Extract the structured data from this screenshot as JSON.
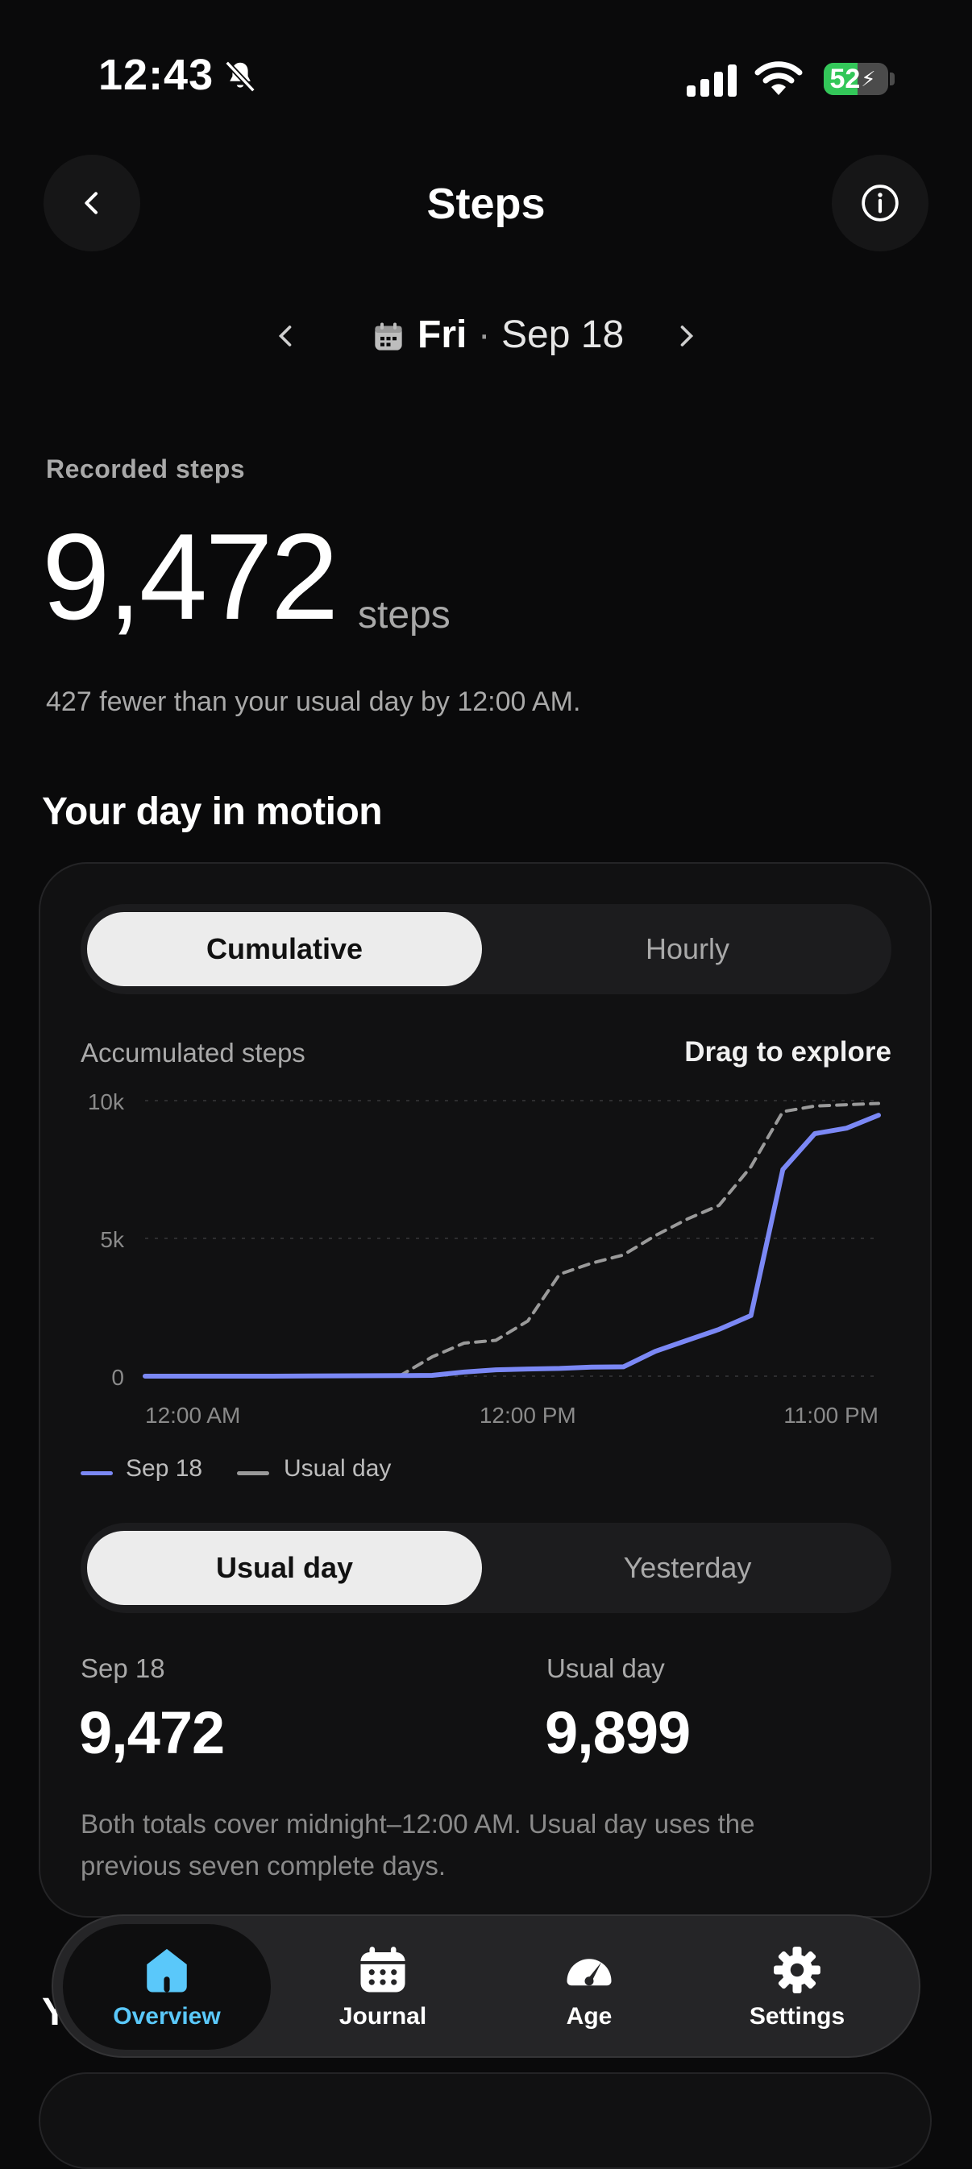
{
  "status_bar": {
    "time": "12:43",
    "battery": "52"
  },
  "header": {
    "title": "Steps"
  },
  "date_nav": {
    "day": "Fri",
    "separator": "·",
    "date": "Sep 18"
  },
  "summary": {
    "label": "Recorded steps",
    "value": "9,472",
    "unit": "steps",
    "comparison": "427 fewer than your usual day by 12:00 AM."
  },
  "section": {
    "title": "Your day in motion"
  },
  "chart_tabs": {
    "options": [
      "Cumulative",
      "Hourly"
    ],
    "selected": "Cumulative"
  },
  "chart_header": {
    "label": "Accumulated steps",
    "hint": "Drag to explore"
  },
  "chart_data": {
    "type": "line",
    "ylabel": "Accumulated steps",
    "y_ticks": [
      "10k",
      "5k",
      "0"
    ],
    "x_ticks": [
      "12:00 AM",
      "12:00 PM",
      "11:00 PM"
    ],
    "ylim": [
      0,
      10000
    ],
    "x_unit": "hour of day",
    "xlim": [
      0,
      23
    ],
    "grid": true,
    "legend_position": "bottom-left",
    "series": [
      {
        "name": "Sep 18",
        "color": "#7b88f5",
        "style": "solid",
        "points": [
          [
            0,
            0
          ],
          [
            4,
            0
          ],
          [
            8,
            20
          ],
          [
            9,
            30
          ],
          [
            10,
            150
          ],
          [
            11,
            230
          ],
          [
            12,
            260
          ],
          [
            13,
            280
          ],
          [
            14,
            330
          ],
          [
            15,
            340
          ],
          [
            16,
            900
          ],
          [
            17,
            1300
          ],
          [
            18,
            1700
          ],
          [
            19,
            2200
          ],
          [
            20,
            7500
          ],
          [
            21,
            8800
          ],
          [
            22,
            9000
          ],
          [
            23,
            9472
          ]
        ]
      },
      {
        "name": "Usual day",
        "color": "#9a9a9a",
        "style": "dashed",
        "points": [
          [
            0,
            0
          ],
          [
            4,
            0
          ],
          [
            8,
            20
          ],
          [
            9,
            700
          ],
          [
            10,
            1200
          ],
          [
            11,
            1300
          ],
          [
            12,
            2000
          ],
          [
            13,
            3700
          ],
          [
            14,
            4100
          ],
          [
            15,
            4400
          ],
          [
            16,
            5100
          ],
          [
            17,
            5700
          ],
          [
            18,
            6200
          ],
          [
            19,
            7600
          ],
          [
            20,
            9600
          ],
          [
            21,
            9800
          ],
          [
            22,
            9850
          ],
          [
            23,
            9899
          ]
        ]
      }
    ]
  },
  "legend": {
    "series1": "Sep 18",
    "series2": "Usual day",
    "series1_color": "#7b88f5",
    "series2_color": "#9a9a9a"
  },
  "compare_tabs": {
    "options": [
      "Usual day",
      "Yesterday"
    ],
    "selected": "Usual day"
  },
  "comparison_stats": {
    "left": {
      "label": "Sep 18",
      "value": "9,472"
    },
    "right": {
      "label": "Usual day",
      "value": "9,899"
    }
  },
  "note": "Both totals cover midnight–12:00 AM. Usual day uses the previous seven complete days.",
  "peek": {
    "text": "Y"
  },
  "tabbar": {
    "items": [
      {
        "label": "Overview",
        "icon": "home-icon",
        "active": true
      },
      {
        "label": "Journal",
        "icon": "calendar-icon",
        "active": false
      },
      {
        "label": "Age",
        "icon": "gauge-icon",
        "active": false
      },
      {
        "label": "Settings",
        "icon": "gear-icon",
        "active": false
      }
    ],
    "accent": "#5ac8fa"
  }
}
